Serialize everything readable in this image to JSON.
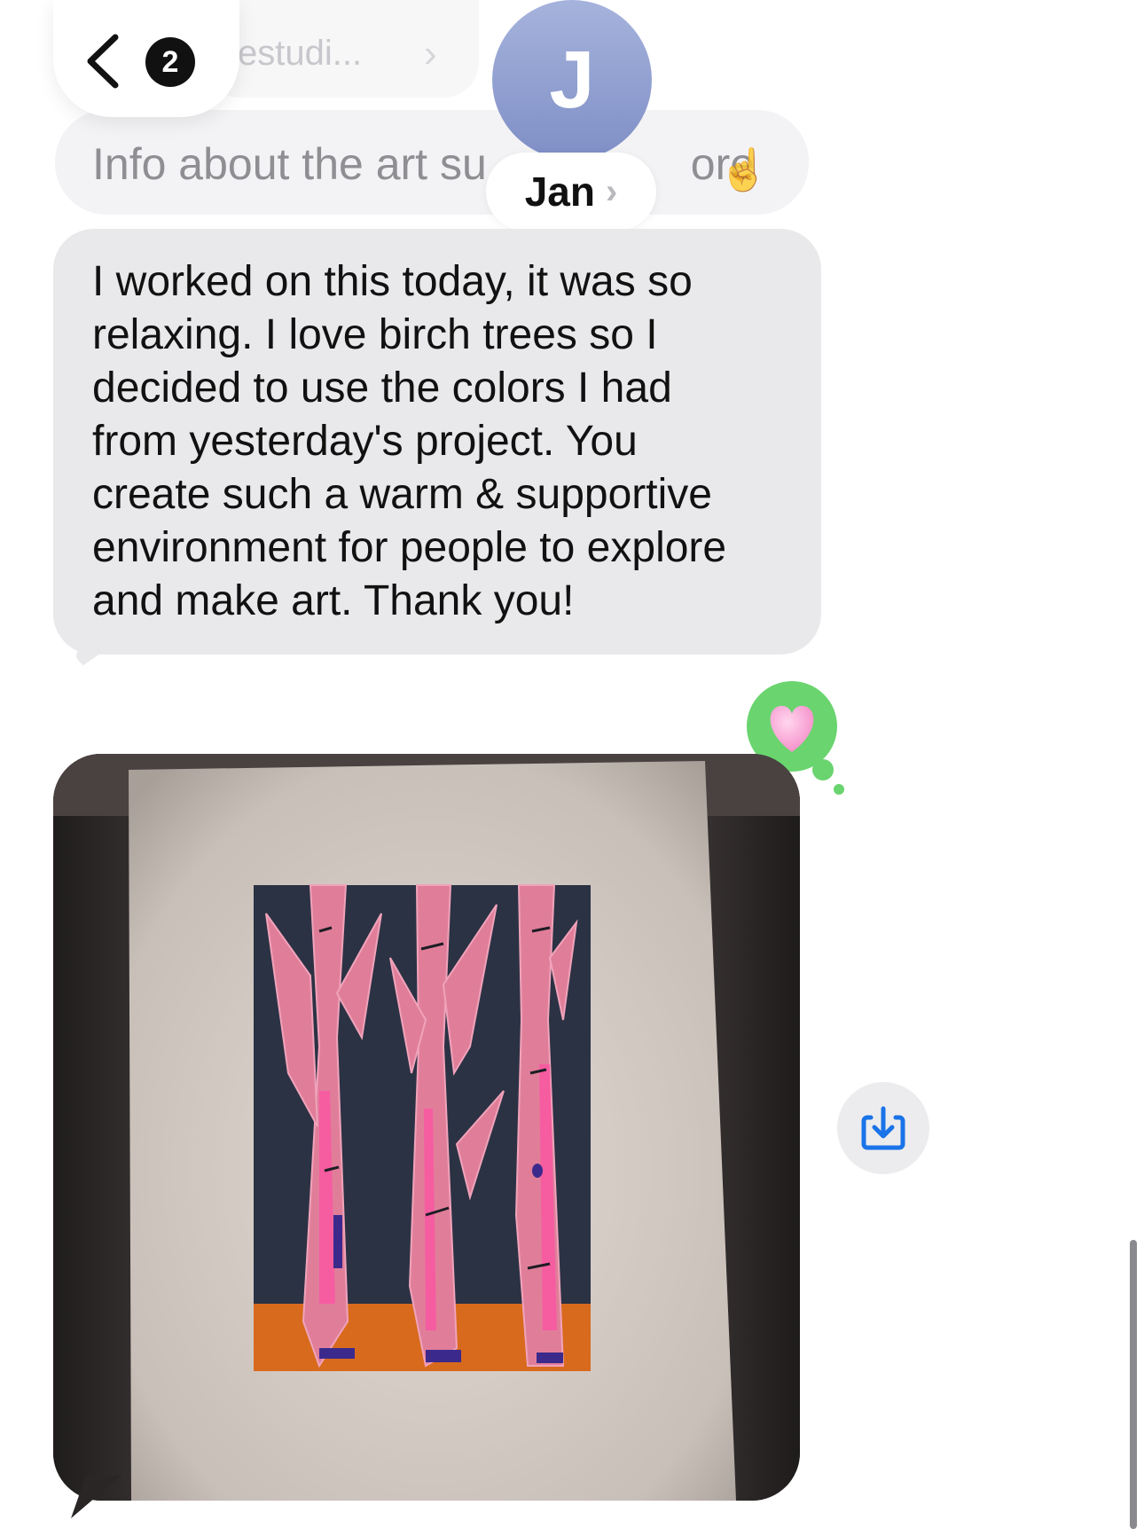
{
  "header": {
    "back_badge_count": "2",
    "faded_conversation_title": "estudi...",
    "faded_chevron": "›",
    "contact_initial": "J",
    "contact_name": "Jan",
    "contact_chevron": "›"
  },
  "previous_message": {
    "text": "Info about the art su",
    "text_tail": "ore",
    "emoji": "☝️"
  },
  "message": {
    "text": "I worked on this today, it was so\nrelaxing. I love birch trees so I\ndecided to use the colors I had\nfrom yesterday's project.  You\ncreate such a warm & supportive\nenvironment for people to explore\nand make art. Thank you!"
  },
  "reaction": {
    "icon": "heart-icon",
    "color": "#6ad46f",
    "heart_color": "#ff9ad0"
  },
  "colors": {
    "received_bubble": "#e9e9eb",
    "avatar_top": "#a6b3dc",
    "avatar_bottom": "#7f8fc6",
    "save_icon": "#1a73e8"
  }
}
